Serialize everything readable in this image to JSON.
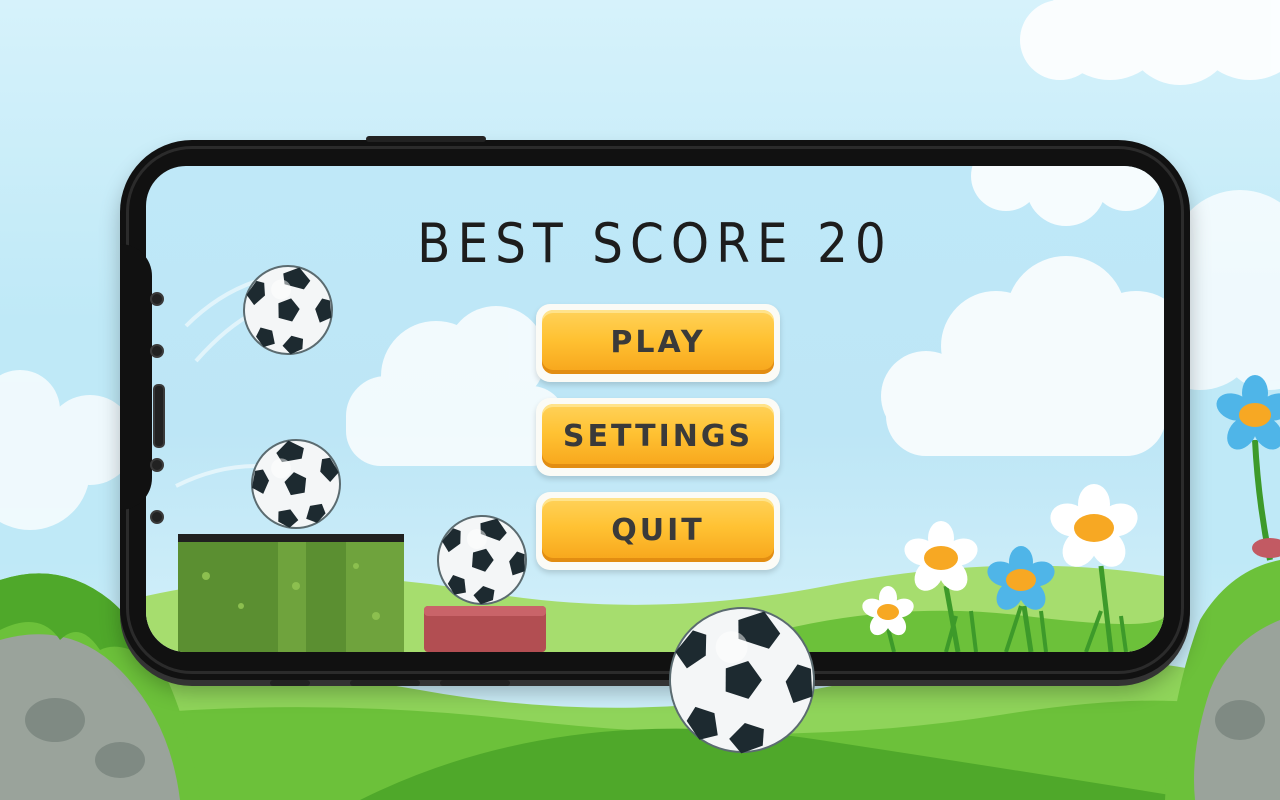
{
  "game": {
    "best_score_label": "BEST SCORE",
    "best_score_value": "20"
  },
  "menu": {
    "play_label": "PLAY",
    "settings_label": "SETTINGS",
    "quit_label": "QUIT"
  },
  "colors": {
    "sky": "#bfe9f7",
    "button_orange": "#ffc233",
    "button_border": "#fbfbf6",
    "hill_green": "#6cc13a",
    "phone_body": "#111111",
    "flower_blue": "#4fb5e8",
    "flower_center": "#f7a823"
  },
  "icons": {
    "ball": "soccer-ball-icon",
    "flower": "daisy-icon"
  }
}
